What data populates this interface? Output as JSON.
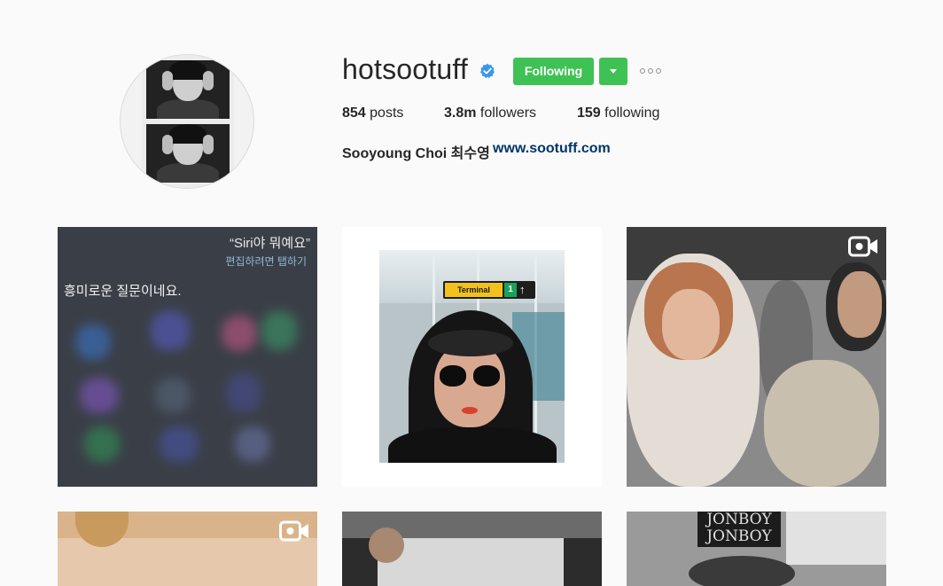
{
  "profile": {
    "username": "hotsootuff",
    "verified_icon": "verified-badge-icon",
    "follow_button_label": "Following",
    "dropdown_icon": "caret-down-icon",
    "more_icon": "ellipsis-icon",
    "stats": {
      "posts_count": "854",
      "posts_label": " posts",
      "followers_count": "3.8m",
      "followers_label": " followers",
      "following_count": "159",
      "following_label": " following"
    },
    "full_name": "Sooyoung Choi 최수영",
    "website": "www.sootuff.com"
  },
  "posts": [
    {
      "type": "image",
      "siri_quote": "“Siri야 뭐예요”",
      "siri_edit_hint": "편집하려면 탭하기",
      "siri_answer": "흥미로운 질문이네요."
    },
    {
      "type": "image",
      "sign_text": "Terminal",
      "sign_number": "1",
      "sign_arrow": "↑"
    },
    {
      "type": "video",
      "video_icon": "video-camera-icon"
    },
    {
      "type": "video",
      "video_icon": "video-camera-icon"
    },
    {
      "type": "image"
    },
    {
      "type": "image",
      "sign_text": "JONBOY JONBOY"
    }
  ],
  "colors": {
    "follow_green": "#3fc254",
    "link_blue": "#003569",
    "background": "#fafafa"
  }
}
